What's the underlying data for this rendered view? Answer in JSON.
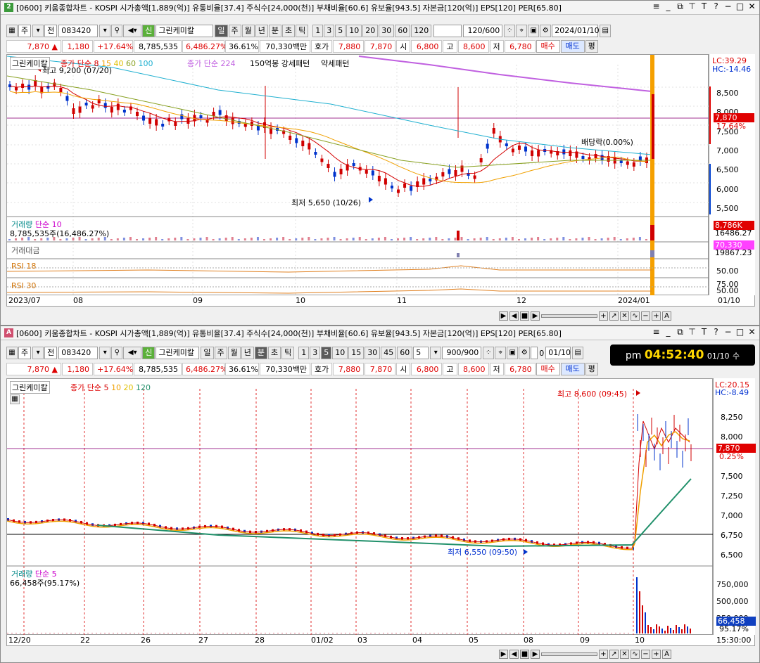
{
  "top": {
    "title": "[0600] 키움종합차트 - KOSPI 시가총액[1,889(억)] 유통비율[37.4] 주식수[24,000(천)] 부채비율[60.6] 유보율[943.5] 자본금[120(억)] EPS[120] PER[65.80]",
    "badge": "2",
    "toolbar": {
      "market": "주",
      "prev": "전",
      "code": "083420",
      "new": "신",
      "name": "그린케미칼",
      "periods": [
        "일",
        "주",
        "월",
        "년",
        "분",
        "초",
        "틱"
      ],
      "counts": [
        "1",
        "3",
        "5",
        "10",
        "20",
        "30",
        "60",
        "120"
      ],
      "range": "120/600",
      "date": "2024/01/10"
    },
    "quote": {
      "price": "7,870 ▲",
      "change": "1,180",
      "rate": "+17.64%",
      "volume": "8,785,535",
      "vol_rate": "6,486.27%",
      "turnover": "36.61%",
      "amount": "70,330백만",
      "bid_label": "호가",
      "bid": "7,880",
      "ask": "7,870",
      "open_label": "시",
      "open": "6,800",
      "high_label": "고",
      "high": "8,600",
      "low_label": "저",
      "low": "6,780",
      "buy": "매수",
      "sell": "매도",
      "avg": "평"
    },
    "legend": {
      "name": "그린케미칼",
      "ma_label": "종가 단순",
      "ma": [
        "8",
        "15",
        "40",
        "60",
        "100"
      ],
      "ma2_label": "종가 단순 224",
      "pattern1": "150억봉 강세패턴",
      "pattern2": "약세패턴"
    },
    "annotations": {
      "high": "최고 9,200 (07/20)",
      "low": "최저 5,650 (10/26)",
      "dividend": "배당락(0.00%)"
    },
    "price_axis": [
      "8,500",
      "8,000",
      "7,500",
      "7,000",
      "6,500",
      "6,000",
      "5,500"
    ],
    "axis_top": [
      "LC:39.29",
      "HC:-14.46"
    ],
    "price_tag": "7,870",
    "price_pct": "17.64%",
    "volume_panel": {
      "title": "거래량",
      "type": "단순 10",
      "value": "8,785,535주(16,486.27%)",
      "tag": "8,786K",
      "pct": "16486.27"
    },
    "amount_panel": {
      "title": "거래대금",
      "tag": "70,330",
      "pct": "19867.23"
    },
    "rsi1": {
      "title": "RSI 18",
      "axis": "50.00"
    },
    "rsi2": {
      "title": "RSI 30",
      "axis1": "75.00",
      "axis2": "50.00"
    },
    "dates": [
      "2023/07",
      "08",
      "09",
      "10",
      "11",
      "12",
      "2024/01",
      "01/10"
    ]
  },
  "bottom": {
    "title": "[0600] 키움종합차트 - KOSPI 시가총액[1,889(억)] 유통비율[37.4] 주식수[24,000(천)] 부채비율[60.6] 유보율[943.5] 자본금[120(억)] EPS[120] PER[65.80]",
    "badge": "A",
    "toolbar": {
      "market": "주",
      "prev": "전",
      "code": "083420",
      "new": "신",
      "name": "그린케미칼",
      "periods": [
        "일",
        "주",
        "월",
        "년",
        "분",
        "초",
        "틱"
      ],
      "counts": [
        "1",
        "3",
        "5",
        "10",
        "15",
        "30",
        "45",
        "60"
      ],
      "interval": "5",
      "range": "900/900",
      "check": "0",
      "date": "01/10"
    },
    "clock": {
      "ampm": "pm",
      "time": "04:52:40",
      "date": "01/10",
      "day": "수"
    },
    "legend": {
      "name": "그린케미칼",
      "ma_label": "종가 단순",
      "ma": [
        "5",
        "10",
        "20",
        "120"
      ]
    },
    "annotations": {
      "high": "최고 8,600 (09:45)",
      "low": "최저 6,550 (09:50)"
    },
    "price_axis": [
      "8,250",
      "8,000",
      "7,750",
      "7,500",
      "7,250",
      "7,000",
      "6,750",
      "6,500"
    ],
    "axis_top": [
      "LC:20.15",
      "HC:-8.49"
    ],
    "price_tag": "7,870",
    "price_pct": "0.25%",
    "volume_panel": {
      "title": "거래량",
      "type": "단순 5",
      "value": "66,458주(95.17%)",
      "tag": "66,458",
      "pct": "95.17%",
      "axis": [
        "750,000",
        "500,000",
        "250,000"
      ]
    },
    "dates": [
      "12/20",
      "22",
      "26",
      "27",
      "28",
      "01/02",
      "03",
      "04",
      "05",
      "08",
      "09",
      "10",
      "15:30:00"
    ]
  },
  "colors": {
    "up": "#d00000",
    "down": "#0033cc",
    "ma5": "#d40000",
    "ma10": "#f0a000",
    "ma20": "#88a020",
    "ma60": "#20b0d0",
    "ma224": "#c060e0",
    "ma120": "#20906a"
  }
}
